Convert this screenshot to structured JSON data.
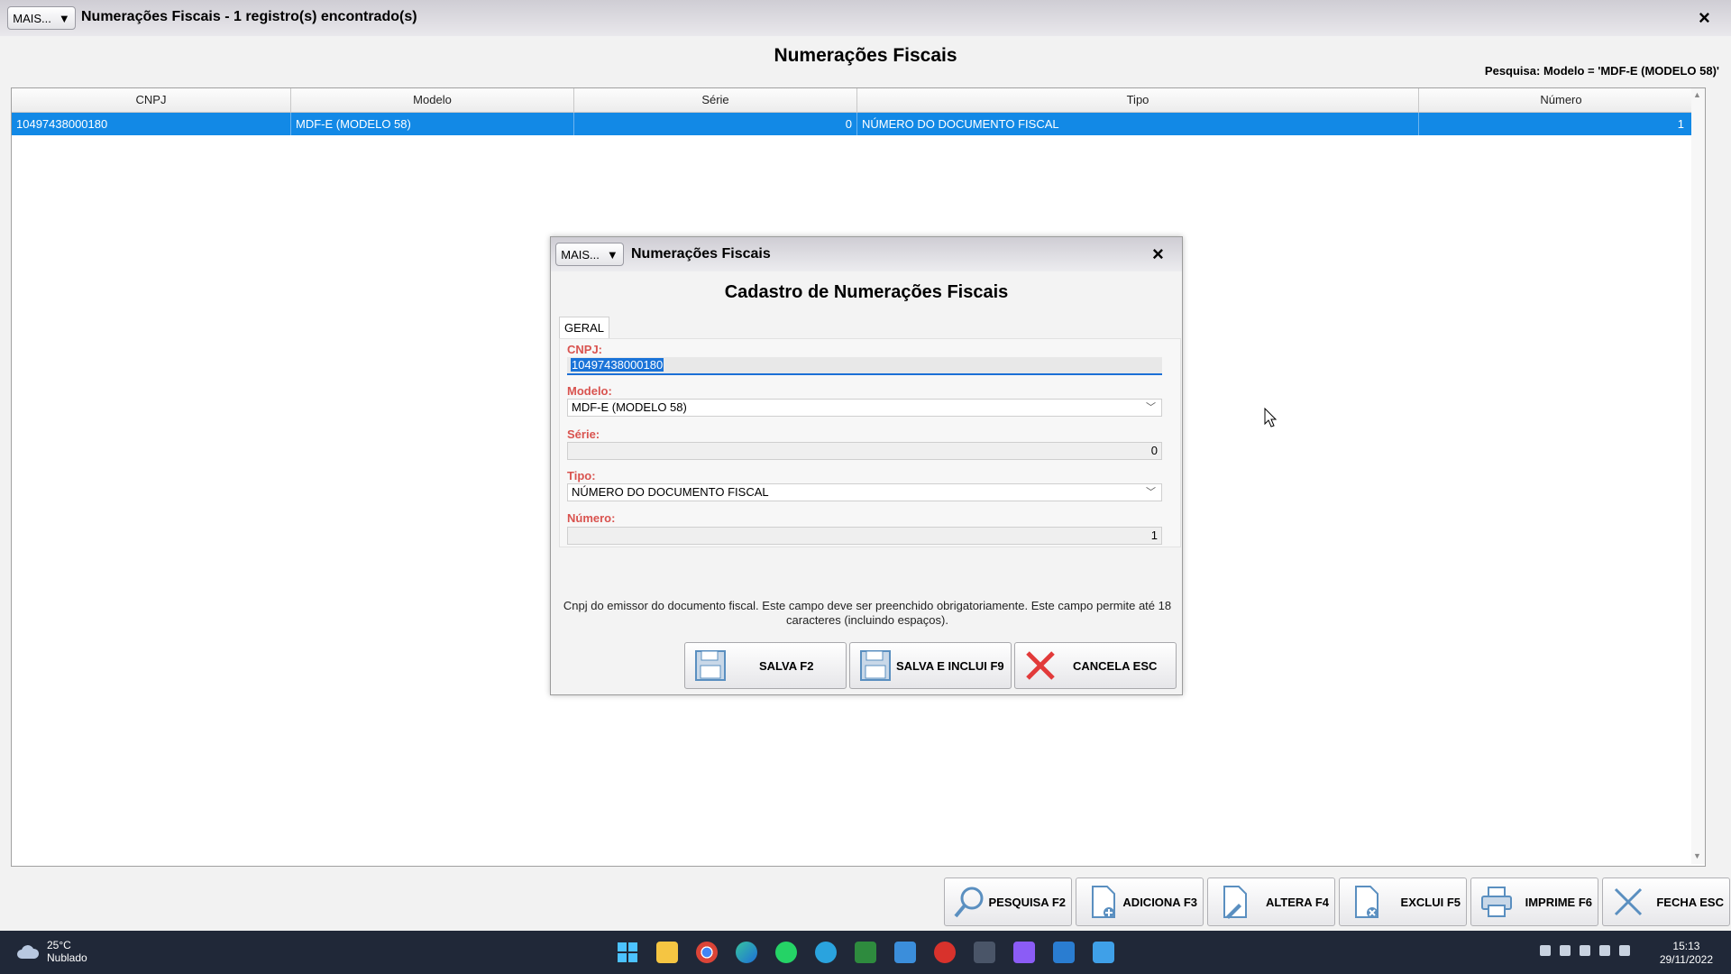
{
  "window": {
    "mais_label": "MAIS...",
    "title": "Numerações Fiscais - 1 registro(s) encontrado(s)",
    "close_label": "×",
    "heading": "Numerações Fiscais",
    "search_info": "Pesquisa: Modelo = 'MDF-E (MODELO 58)'"
  },
  "grid": {
    "columns": [
      "CNPJ",
      "Modelo",
      "Série",
      "Tipo",
      "Número"
    ],
    "rows": [
      {
        "cnpj": "10497438000180",
        "modelo": "MDF-E (MODELO 58)",
        "serie": "0",
        "tipo": "NÚMERO DO DOCUMENTO FISCAL",
        "numero": "1"
      }
    ],
    "selected_row": 0
  },
  "toolbar": {
    "pesquisa": "PESQUISA F2",
    "adiciona": "ADICIONA F3",
    "altera": "ALTERA F4",
    "exclui": "EXCLUI F5",
    "imprime": "IMPRIME F6",
    "fecha": "FECHA ESC"
  },
  "dialog": {
    "mais_label": "MAIS...",
    "title": "Numerações Fiscais",
    "close_label": "×",
    "heading": "Cadastro de Numerações Fiscais",
    "tab": "GERAL",
    "fields": {
      "cnpj_label": "CNPJ:",
      "cnpj_value": "10497438000180",
      "modelo_label": "Modelo:",
      "modelo_value": "MDF-E (MODELO 58)",
      "serie_label": "Série:",
      "serie_value": "0",
      "tipo_label": "Tipo:",
      "tipo_value": "NÚMERO DO DOCUMENTO FISCAL",
      "numero_label": "Número:",
      "numero_value": "1"
    },
    "hint_line1": "Cnpj do emissor do documento fiscal. Este campo deve ser preenchido obrigatoriamente. Este campo permite até 18",
    "hint_line2": "caracteres (incluindo espaços).",
    "buttons": {
      "salva": "SALVA F2",
      "salva_inclui": "SALVA E INCLUI F9",
      "cancela": "CANCELA ESC"
    }
  },
  "taskbar": {
    "temperature": "25°C",
    "weather": "Nublado",
    "time": "15:13",
    "date": "29/11/2022",
    "icons": [
      "windows-start-icon",
      "file-explorer-icon",
      "chrome-icon",
      "edge-icon",
      "whatsapp-icon",
      "telegram-icon",
      "spreadsheet-icon",
      "mail-icon",
      "app-red-icon",
      "app-gear-icon",
      "app-purple-icon",
      "app-window-icon",
      "notepad-icon"
    ],
    "colors": {
      "bar": "#202838",
      "accent": "#1289e6"
    }
  }
}
